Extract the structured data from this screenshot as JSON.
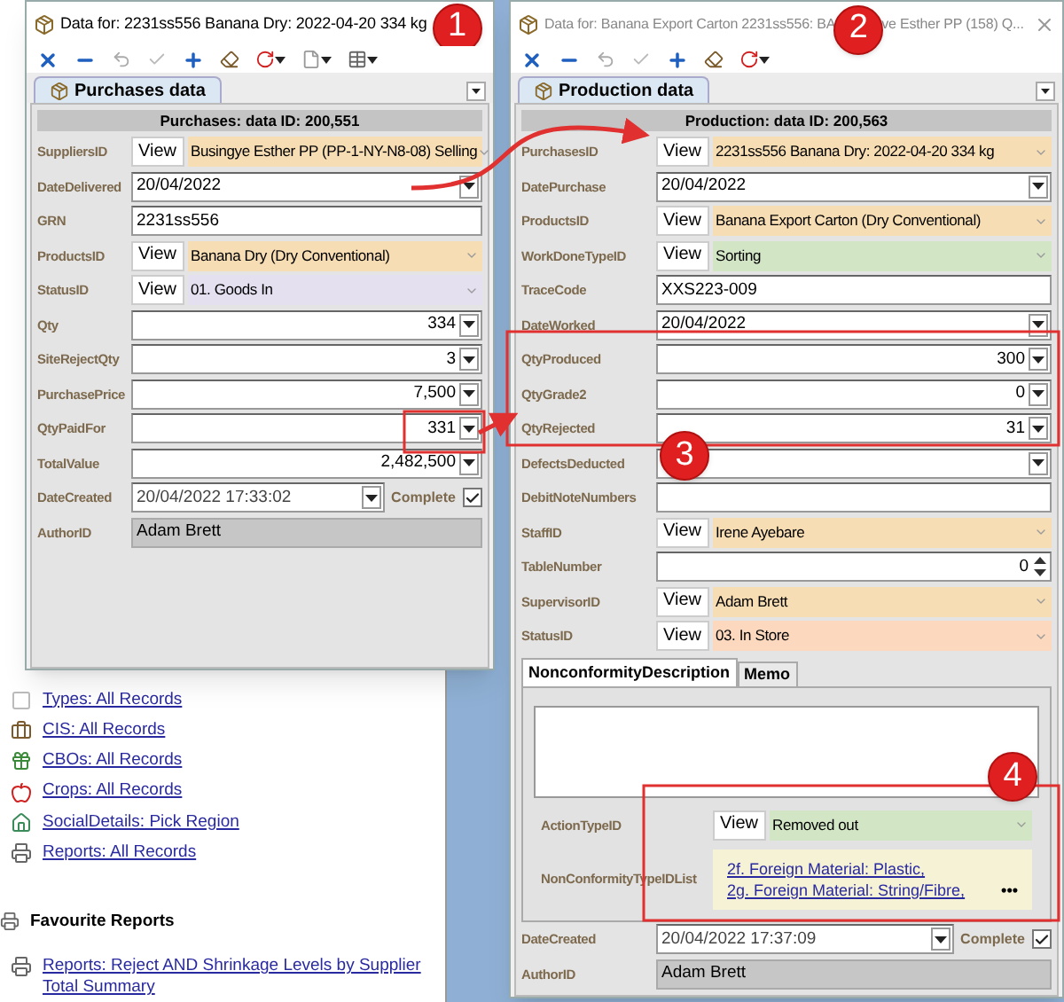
{
  "background": {
    "links": [
      {
        "kind": "type",
        "text": "Types: All Records"
      },
      {
        "kind": "cis",
        "text": "CIS: All Records"
      },
      {
        "kind": "cbo",
        "text": "CBOs: All Records"
      },
      {
        "kind": "crop",
        "text": "Crops: All Records"
      },
      {
        "kind": "social",
        "text": "SocialDetails: Pick Region"
      },
      {
        "kind": "report",
        "text": "Reports: All Records"
      }
    ],
    "favourites_heading": "Favourite Reports",
    "favourite_links": [
      "Reports: Reject AND Shrinkage Levels by Supplier Total Summary"
    ]
  },
  "windows": [
    {
      "title": "Data for: 2231ss556 Banana Dry: 2022-04-20 334 kg",
      "active": true,
      "callout": "1",
      "extended_toolbar": true,
      "tab": "Purchases data",
      "header": "Purchases: data ID: 200,551",
      "fields": [
        {
          "label": "SuppliersID",
          "kind": "lookup",
          "button": "View",
          "value": "Busingye Esther PP (PP-1-NY-N8-08) Selling",
          "color": "#f7ddb3"
        },
        {
          "label": "DateDelivered",
          "kind": "date",
          "value": "20/04/2022"
        },
        {
          "label": "GRN",
          "kind": "text",
          "value": "2231ss556"
        },
        {
          "label": "ProductsID",
          "kind": "lookup",
          "button": "View",
          "value": "Banana Dry (Dry Conventional)",
          "color": "#f7ddb3"
        },
        {
          "label": "StatusID",
          "kind": "lookup",
          "button": "View",
          "value": "01. Goods In",
          "color": "#e4e0f0"
        },
        {
          "label": "Qty",
          "kind": "number",
          "value": "334"
        },
        {
          "label": "SiteRejectQty",
          "kind": "number",
          "value": "3"
        },
        {
          "label": "PurchasePrice",
          "kind": "number",
          "value": "7,500"
        },
        {
          "label": "QtyPaidFor",
          "kind": "number",
          "value": "331"
        },
        {
          "label": "TotalValue",
          "kind": "number",
          "value": "2,482,500"
        },
        {
          "label": "DateCreated",
          "kind": "created",
          "value": "20/04/2022 17:33:02",
          "check_label": "Complete",
          "checked": true
        },
        {
          "label": "AuthorID",
          "kind": "readonly",
          "value": "Adam Brett"
        }
      ]
    },
    {
      "title": "Data for: Banana Export Carton 2231ss556: BA",
      "title_end": "ve Esther PP (158) Q...",
      "active": false,
      "callout": "2",
      "extended_toolbar": false,
      "tab": "Production data",
      "header": "Production: data ID: 200,563",
      "fields": [
        {
          "label": "PurchasesID",
          "kind": "lookup",
          "button": "View",
          "value": "2231ss556 Banana Dry: 2022-04-20 334 kg",
          "color": "#f7ddb3"
        },
        {
          "label": "DatePurchase",
          "kind": "date",
          "value": "20/04/2022"
        },
        {
          "label": "ProductsID",
          "kind": "lookup",
          "button": "View",
          "value": "Banana Export Carton (Dry Conventional)",
          "color": "#f7ddb3"
        },
        {
          "label": "WorkDoneTypeID",
          "kind": "lookup",
          "button": "View",
          "value": "Sorting",
          "color": "#d2e6c6"
        },
        {
          "label": "TraceCode",
          "kind": "text",
          "value": "XXS223-009"
        },
        {
          "label": "DateWorked",
          "kind": "date",
          "value": "20/04/2022"
        },
        {
          "label": "QtyProduced",
          "kind": "number",
          "value": "300"
        },
        {
          "label": "QtyGrade2",
          "kind": "number",
          "value": "0"
        },
        {
          "label": "QtyRejected",
          "kind": "number",
          "value": "31"
        },
        {
          "label": "DefectsDeducted",
          "kind": "number"
        },
        {
          "label": "DebitNoteNumbers",
          "kind": "text"
        },
        {
          "label": "StaffID",
          "kind": "lookup",
          "button": "View",
          "value": "Irene Ayebare",
          "color": "#f7ddb3"
        },
        {
          "label": "TableNumber",
          "kind": "spin",
          "value": "0"
        },
        {
          "label": "SupervisorID",
          "kind": "lookup",
          "button": "View",
          "value": "Adam Brett",
          "color": "#f7ddb3"
        },
        {
          "label": "StatusID",
          "kind": "lookup",
          "button": "View",
          "value": "03. In Store",
          "color": "#fcd9be"
        }
      ],
      "subtabs": [
        {
          "label": "NonconformityDescription",
          "selected": true
        },
        {
          "label": "Memo",
          "selected": false
        }
      ],
      "sub_fields": [
        {
          "label": "ActionTypeID",
          "kind": "lookup",
          "button": "View",
          "value": "Removed out",
          "color": "#d2e6c6"
        },
        {
          "label": "NonConformityTypeIDList",
          "kind": "list",
          "items": [
            "2f. Foreign Material: Plastic,",
            "2g. Foreign Material: String/Fibre,"
          ],
          "more": "•••"
        }
      ],
      "footer": [
        {
          "label": "DateCreated",
          "kind": "created",
          "value": "20/04/2022 17:37:09",
          "check_label": "Complete",
          "checked": true
        },
        {
          "label": "AuthorID",
          "kind": "readonly",
          "value": "Adam Brett"
        }
      ]
    }
  ],
  "annotations": {
    "callouts": [
      "3",
      "4"
    ]
  }
}
